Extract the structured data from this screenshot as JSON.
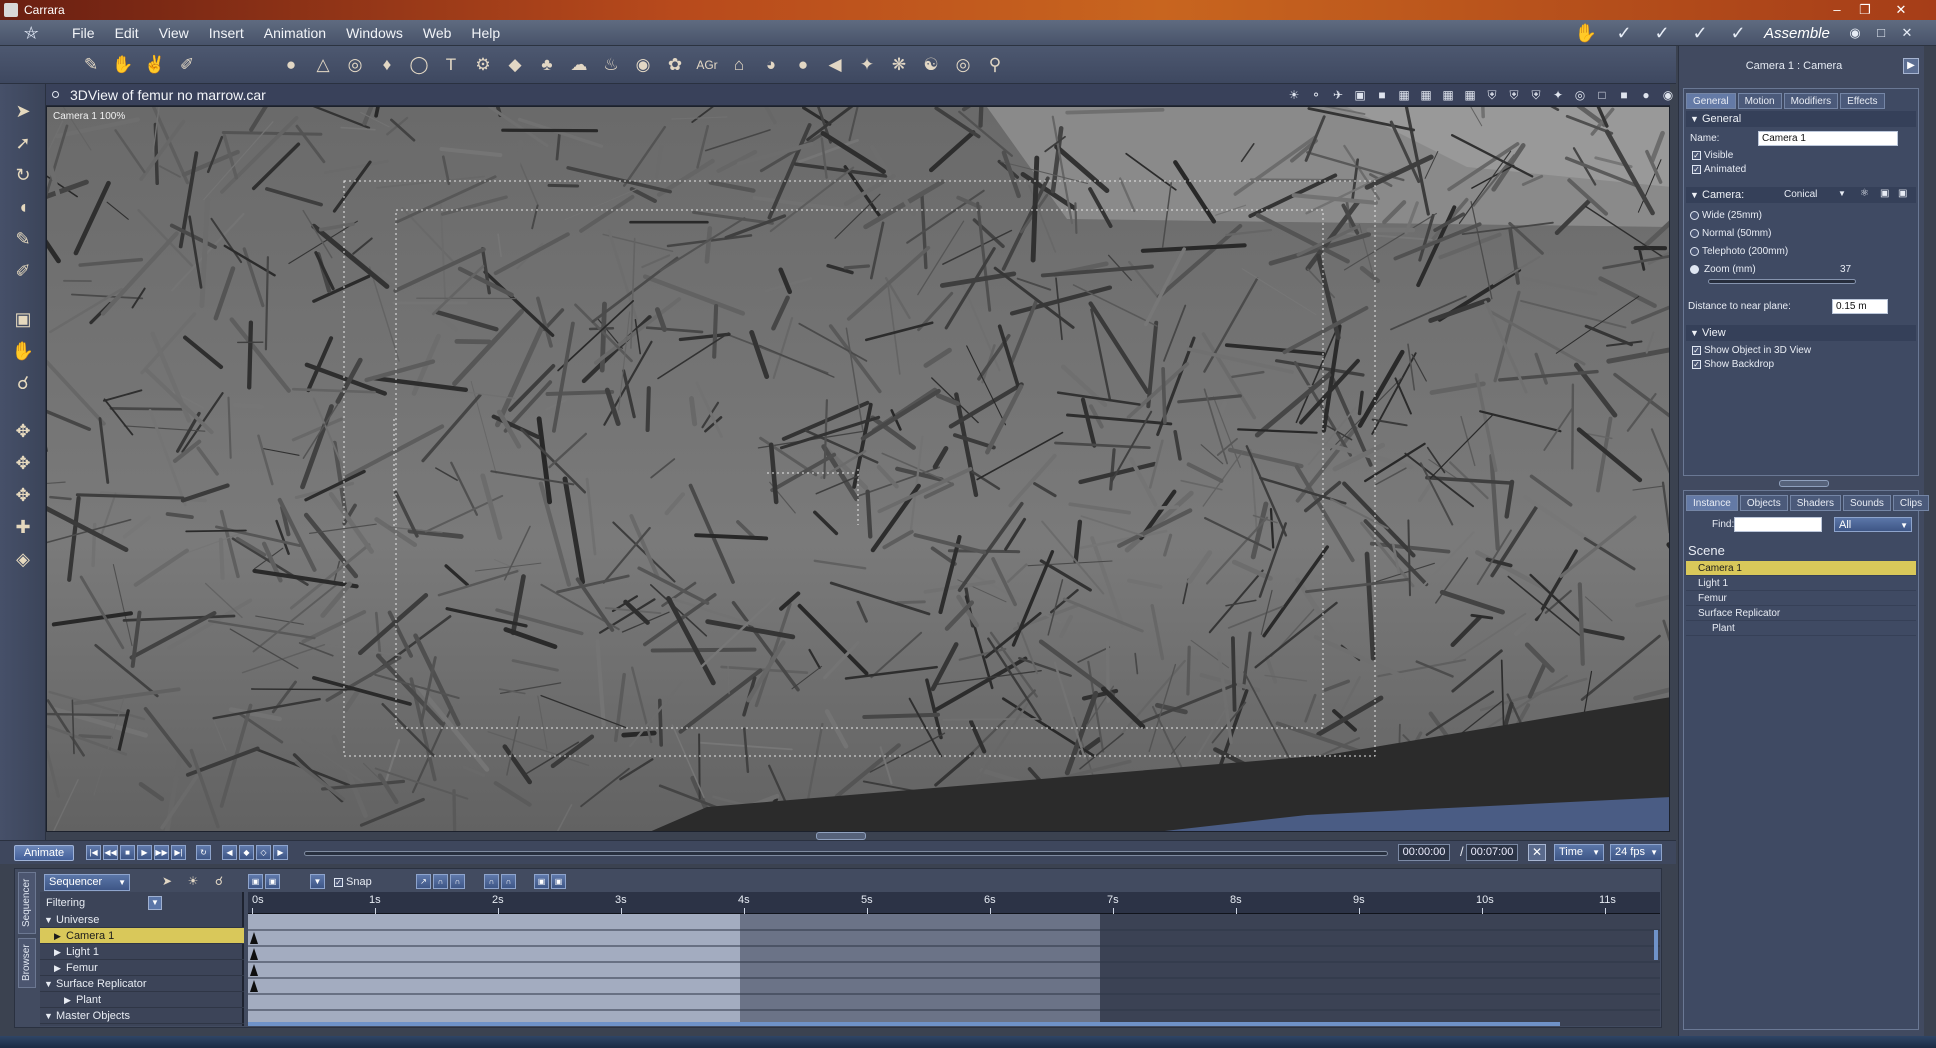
{
  "window": {
    "title": "Carrara"
  },
  "menu": {
    "items": [
      "File",
      "Edit",
      "View",
      "Insert",
      "Animation",
      "Windows",
      "Web",
      "Help"
    ]
  },
  "room": {
    "name": "Assemble"
  },
  "toolbar": {
    "tools": [
      "pencil-icon",
      "hand-icon",
      "hand-outline-icon",
      "paintbrush-icon"
    ],
    "inserts": [
      "sphere-icon",
      "cone-icon",
      "sphere-grid-icon",
      "primitives-icon",
      "torus-icon",
      "text-icon",
      "gear-icon",
      "plane-icon",
      "tree-icon",
      "cloud-icon",
      "flame-icon",
      "ball-icon",
      "fern-icon",
      "text-3d-icon",
      "house-icon",
      "pot-icon",
      "bowl-icon",
      "sail-icon",
      "bulb-icon",
      "bug-icon",
      "figure-icon",
      "target-icon",
      "bone-icon"
    ],
    "text3d_label": "AGr"
  },
  "view": {
    "title": "3DView of femur no marrow.car",
    "camera_label": "Camera 1  100%"
  },
  "transport": {
    "animate_label": "Animate",
    "current_time": "00:00:00",
    "end_time": "00:07:00",
    "separator": "/",
    "time_mode": "Time",
    "fps": "24 fps"
  },
  "sequencer": {
    "mode": "Sequencer",
    "snap_label": "Snap",
    "filtering_label": "Filtering",
    "tab_sequencer": "Sequencer",
    "tab_browser": "Browser",
    "tree": [
      {
        "label": "Universe",
        "indent": 0,
        "expanded": true,
        "selected": false
      },
      {
        "label": "Camera 1",
        "indent": 1,
        "expanded": false,
        "selected": true
      },
      {
        "label": "Light 1",
        "indent": 1,
        "expanded": false,
        "selected": false
      },
      {
        "label": "Femur",
        "indent": 1,
        "expanded": false,
        "selected": false
      },
      {
        "label": "Surface Replicator",
        "indent": 0,
        "expanded": true,
        "selected": false
      },
      {
        "label": "Plant",
        "indent": 2,
        "expanded": false,
        "selected": false
      },
      {
        "label": "Master Objects",
        "indent": 0,
        "expanded": true,
        "selected": false
      }
    ],
    "ruler_ticks": [
      "0s",
      "1s",
      "2s",
      "3s",
      "4s",
      "5s",
      "6s",
      "7s",
      "8s",
      "9s",
      "10s",
      "11s"
    ]
  },
  "properties": {
    "title": "Camera 1 : Camera",
    "tabs": [
      "General",
      "Motion",
      "Modifiers",
      "Effects"
    ],
    "general_header": "General",
    "name_label": "Name:",
    "name_value": "Camera 1",
    "visible_label": "Visible",
    "animated_label": "Animated",
    "camera_header": "Camera:",
    "camera_type": "Conical",
    "lens_options": [
      "Wide (25mm)",
      "Normal (50mm)",
      "Telephoto (200mm)",
      "Zoom (mm)"
    ],
    "zoom_value": "37",
    "near_plane_label": "Distance to near plane:",
    "near_plane_value": "0.15 m",
    "view_header": "View",
    "show_object_label": "Show Object in 3D View",
    "show_backdrop_label": "Show Backdrop"
  },
  "browser": {
    "tabs": [
      "Instance",
      "Objects",
      "Shaders",
      "Sounds",
      "Clips"
    ],
    "find_label": "Find:",
    "find_value": "",
    "filter_value": "All",
    "scene_label": "Scene",
    "items": [
      {
        "label": "Camera 1",
        "selected": true
      },
      {
        "label": "Light 1",
        "selected": false
      },
      {
        "label": "Femur",
        "selected": false
      },
      {
        "label": "Surface Replicator",
        "selected": false
      },
      {
        "label": "Plant",
        "selected": false
      }
    ]
  },
  "colors": {
    "selection": "#d9c85a",
    "panel": "#414a60",
    "viewport_bg": "#6f6f6f"
  }
}
